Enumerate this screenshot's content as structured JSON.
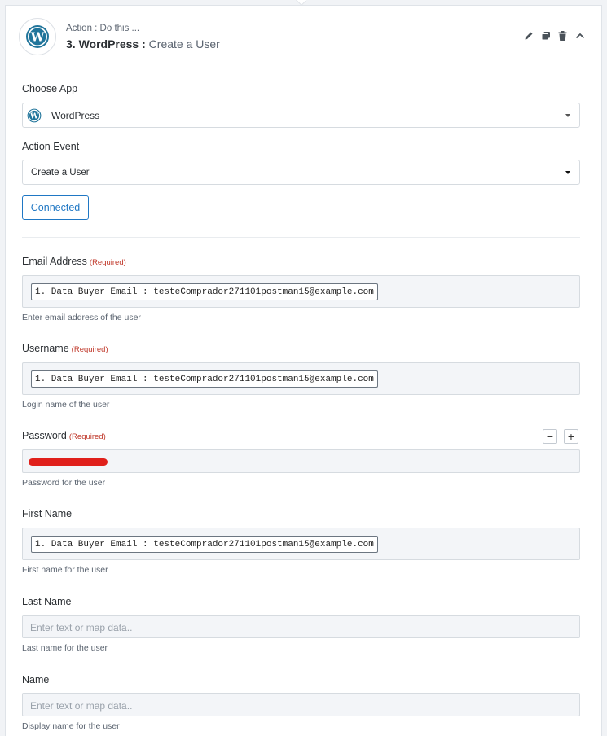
{
  "header": {
    "subtitle": "Action : Do this ...",
    "step_title": "3. WordPress :",
    "event_title": "Create a User",
    "icons": [
      "pencil-icon",
      "copy-icon",
      "trash-icon",
      "chevron-up-icon"
    ]
  },
  "choose_app": {
    "label": "Choose App",
    "value": "WordPress"
  },
  "action_event": {
    "label": "Action Event",
    "value": "Create a User"
  },
  "connected_label": "Connected",
  "required_text": "(Required)",
  "fields": {
    "email": {
      "label": "Email Address",
      "chip": "1. Data Buyer Email : testeComprador271101postman15@example.com",
      "help": "Enter email address of the user"
    },
    "username": {
      "label": "Username",
      "chip": "1. Data Buyer Email : testeComprador271101postman15@example.com",
      "help": "Login name of the user"
    },
    "password": {
      "label": "Password",
      "help": "Password for the user"
    },
    "first_name": {
      "label": "First Name",
      "chip": "1. Data Buyer Email : testeComprador271101postman15@example.com",
      "help": "First name for the user"
    },
    "last_name": {
      "label": "Last Name",
      "placeholder": "Enter text or map data..",
      "help": "Last name for the user"
    },
    "name": {
      "label": "Name",
      "placeholder": "Enter text or map data..",
      "help": "Display name for the user"
    }
  },
  "minus_label": "−",
  "plus_label": "+",
  "colors": {
    "accent": "#1f77c4",
    "required": "#c0392b",
    "redaction": "#e0201b"
  }
}
